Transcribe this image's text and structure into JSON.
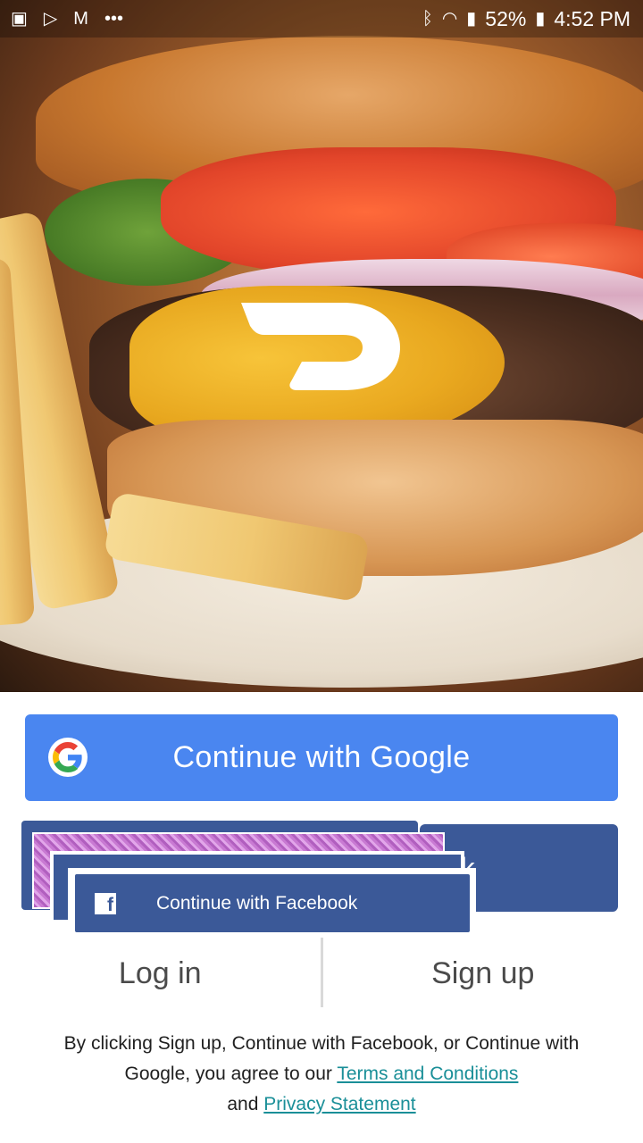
{
  "status_bar": {
    "battery_pct": "52%",
    "time": "4:52 PM",
    "icons": [
      "image-icon",
      "play-store-icon",
      "gmail-icon",
      "more-icon",
      "bluetooth-icon",
      "wifi-icon",
      "signal-icon",
      "battery-icon"
    ]
  },
  "hero": {
    "image_description_icon": "burger-photo",
    "logo_icon": "doordash-logo-icon"
  },
  "buttons": {
    "google_label": "Continue with Google",
    "facebook_label": "Continue with Facebook",
    "facebook_back_fragment": "ok"
  },
  "auth": {
    "login_label": "Log in",
    "signup_label": "Sign up"
  },
  "legal": {
    "prefix": "By clicking Sign up, Continue with Facebook, or Continue with Google, you agree to our ",
    "terms_link": "Terms and Conditions",
    "middle": " and ",
    "privacy_link": "Privacy Statement"
  },
  "colors": {
    "google_blue": "#4a86f0",
    "facebook_blue": "#3b5998",
    "link_teal": "#1a8f98"
  }
}
